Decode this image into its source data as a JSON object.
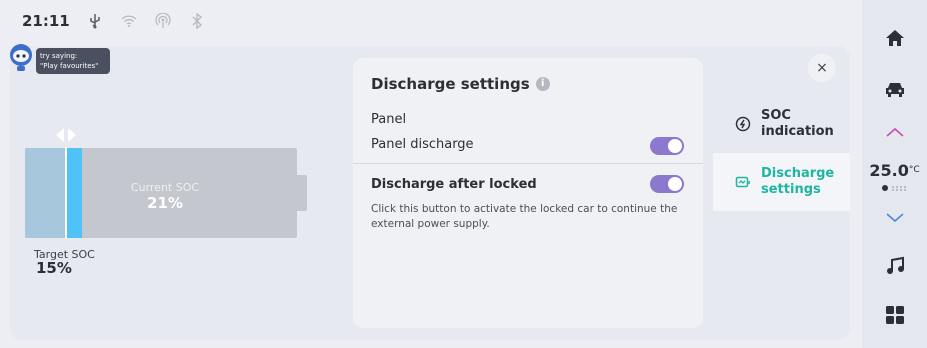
{
  "status_bar": {
    "time": "21:11",
    "icons": [
      "usb-icon",
      "wifi-icon",
      "hotspot-icon",
      "bluetooth-icon"
    ]
  },
  "voice_assistant": {
    "tip_line1": "try saying:",
    "tip_line2": "\"Play favourites\""
  },
  "battery": {
    "current_soc_label": "Current SOC",
    "current_soc_value": "21%",
    "current_soc_percent": 21,
    "target_soc_label": "Target SOC",
    "target_soc_value": "15%",
    "target_soc_percent": 15
  },
  "settings_panel": {
    "title": "Discharge settings",
    "section_label": "Panel",
    "panel_discharge_label": "Panel discharge",
    "panel_discharge_on": true,
    "discharge_after_locked_label": "Discharge after locked",
    "discharge_after_locked_on": true,
    "discharge_after_locked_desc": "Click this button to activate the locked car to continue the external power supply."
  },
  "side_menu": {
    "items": [
      {
        "label_line1": "SOC",
        "label_line2": "indication",
        "icon": "soc-icon",
        "active": false
      },
      {
        "label_line1": "Discharge",
        "label_line2": "settings",
        "icon": "discharge-icon",
        "active": true
      }
    ],
    "close_label": "×"
  },
  "dock": {
    "temperature": "25.0",
    "temperature_unit": "°C"
  },
  "colors": {
    "accent_purple": "#8c78cf",
    "accent_teal": "#1fb5a3",
    "battery_current": "#4fc3f7",
    "battery_target": "#a6c7dc"
  }
}
